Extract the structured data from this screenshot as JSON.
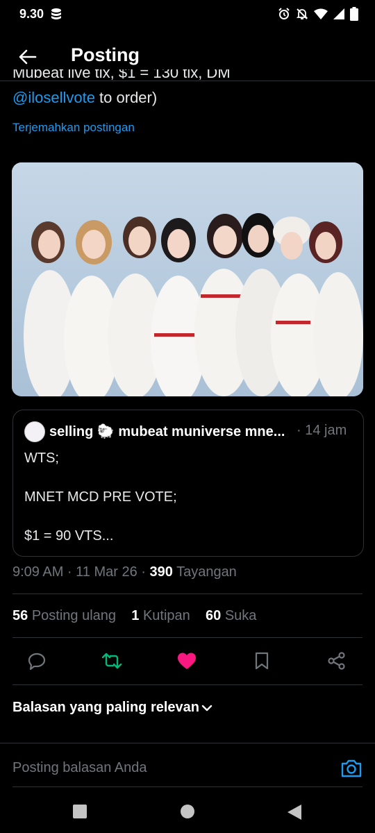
{
  "status": {
    "time": "9.30"
  },
  "header": {
    "title": "Posting"
  },
  "post": {
    "cut_line": "Mubeat live tix, $1 = 130 tix, DM",
    "mention": "@ilosellvote",
    "text_after_mention": " to order)",
    "translate_link": "Terjemahkan postingan"
  },
  "quote": {
    "author": "selling 🐑 mubeat muniverse mne...",
    "time": "· 14 jam",
    "lines": [
      "WTS;",
      "MNET MCD PRE VOTE;",
      "$1 = 90 VTS..."
    ]
  },
  "meta": {
    "time_date": "9:09 AM · 11 Mar 26 · ",
    "views": "390",
    "views_label": " Tayangan"
  },
  "stats": {
    "reposts": "56",
    "reposts_label": "Posting ulang",
    "quotes": "1",
    "quotes_label": "Kutipan",
    "likes": "60",
    "likes_label": "Suka"
  },
  "replies": {
    "sort_label": "Balasan yang paling relevan"
  },
  "reply_bar": {
    "placeholder": "Posting balasan Anda"
  },
  "colors": {
    "accent": "#1d9bf0",
    "like": "#f91880",
    "repost": "#00ba7c",
    "muted": "#71767b"
  },
  "icons": [
    "back-arrow-icon",
    "reply-icon",
    "repost-icon",
    "heart-icon",
    "bookmark-icon",
    "share-icon",
    "chevron-down-icon",
    "camera-icon"
  ]
}
